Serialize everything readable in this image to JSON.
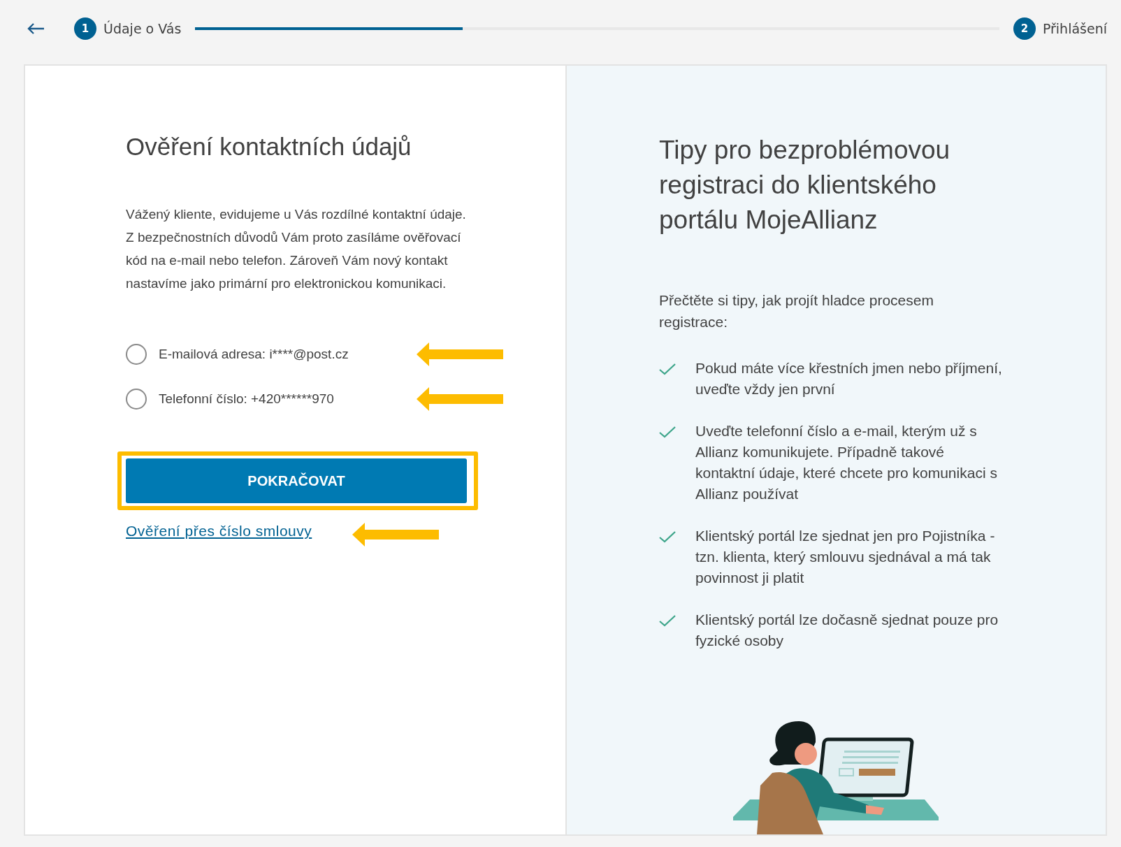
{
  "progress": {
    "steps": [
      {
        "number": "1",
        "label": "Údaje o Vás"
      },
      {
        "number": "2",
        "label": "Přihlášení"
      }
    ],
    "level": 0.333
  },
  "left": {
    "title": "Ověření kontaktních údajů",
    "description": "Vážený kliente, evidujeme u Vás rozdílné kontaktní údaje. Z bezpečnostních důvodů Vám proto zasíláme ověřovací kód na e-mail nebo telefon. Zároveň Vám nový kontakt nastavíme jako primární pro elektronickou komunikaci.",
    "options": [
      {
        "label": "E-mailová adresa: i****@post.cz",
        "checked": false
      },
      {
        "label": "Telefonní číslo: +420******970",
        "checked": false
      }
    ],
    "button": "POKRAČOVAT",
    "link": "Ověření přes číslo smlouvy"
  },
  "right": {
    "title": "Tipy pro bezproblémovou registraci do klientského portálu MojeAllianz",
    "intro": "Přečtěte si tipy, jak projít hladce procesem registrace:",
    "tips": [
      "Pokud máte více křestních jmen nebo příjmení, uveďte vždy jen první",
      "Uveďte telefonní číslo a e-mail, kterým už s Allianz komunikujete. Případně takové kontaktní údaje, které chcete pro komunikaci s Allianz používat",
      "Klientský portál lze sjednat jen pro Pojistníka - tzn. klienta, který smlouvu sjednával a má tak povinnost ji platit",
      "Klientský portál lze dočasně sjednat pouze pro fyzické osoby"
    ]
  }
}
